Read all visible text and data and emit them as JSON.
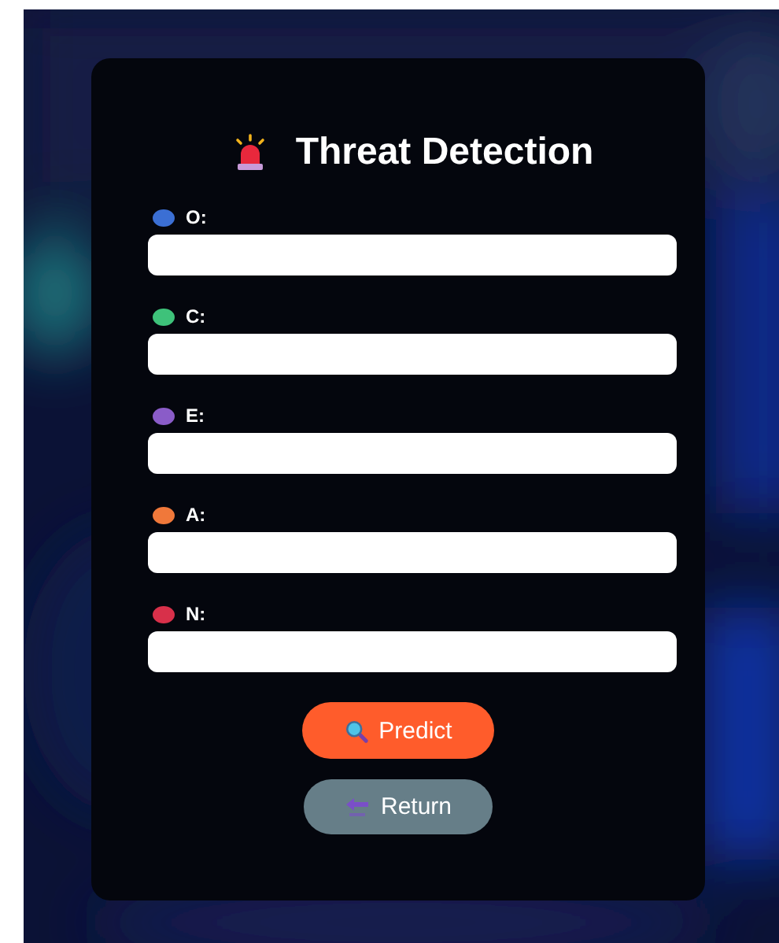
{
  "title": "Threat Detection",
  "fields": [
    {
      "label": "O:",
      "color": "#3b6fd4"
    },
    {
      "label": "C:",
      "color": "#3ec27a"
    },
    {
      "label": "E:",
      "color": "#8a5cc8"
    },
    {
      "label": "A:",
      "color": "#f0783a"
    },
    {
      "label": "N:",
      "color": "#d8304a"
    }
  ],
  "buttons": [
    {
      "kind": "predict",
      "label": "Predict"
    },
    {
      "kind": "return",
      "label": "Return"
    }
  ]
}
